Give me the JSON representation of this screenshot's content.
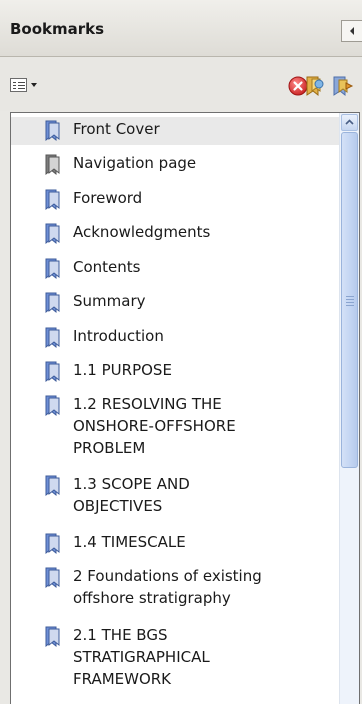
{
  "header": {
    "title": "Bookmarks"
  },
  "colors": {
    "selected_row": "#e9e9e9",
    "bookmark_blue": "#6e8fd6",
    "bookmark_gray": "#7d7d7d"
  },
  "bookmarks": [
    {
      "label": "Front Cover",
      "icon": "bookmark-blue-icon",
      "selected": true
    },
    {
      "label": "Navigation page",
      "icon": "bookmark-gray-icon"
    },
    {
      "label": "Foreword",
      "icon": "bookmark-blue-icon"
    },
    {
      "label": "Acknowledgments",
      "icon": "bookmark-blue-icon"
    },
    {
      "label": "Contents",
      "icon": "bookmark-blue-icon"
    },
    {
      "label": "Summary",
      "icon": "bookmark-blue-icon"
    },
    {
      "label": "Introduction",
      "icon": "bookmark-blue-icon"
    },
    {
      "label": "1.1 PURPOSE",
      "icon": "bookmark-blue-icon"
    },
    {
      "label": "1.2 RESOLVING THE ONSHORE-OFFSHORE PROBLEM",
      "icon": "bookmark-blue-icon"
    },
    {
      "label": "1.3 SCOPE AND OBJECTIVES",
      "icon": "bookmark-blue-icon"
    },
    {
      "label": "1.4 TIMESCALE",
      "icon": "bookmark-blue-icon"
    },
    {
      "label": "2 Foundations of existing offshore stratigraphy",
      "icon": "bookmark-blue-icon"
    },
    {
      "label": "2.1 THE BGS STRATIGRAPHICAL FRAMEWORK",
      "icon": "bookmark-blue-icon"
    }
  ]
}
